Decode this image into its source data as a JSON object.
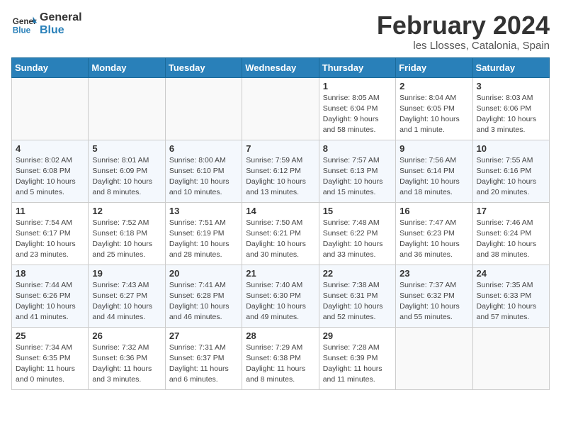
{
  "header": {
    "logo_general": "General",
    "logo_blue": "Blue",
    "month_title": "February 2024",
    "location": "les Llosses, Catalonia, Spain"
  },
  "weekdays": [
    "Sunday",
    "Monday",
    "Tuesday",
    "Wednesday",
    "Thursday",
    "Friday",
    "Saturday"
  ],
  "weeks": [
    [
      {
        "day": "",
        "info": ""
      },
      {
        "day": "",
        "info": ""
      },
      {
        "day": "",
        "info": ""
      },
      {
        "day": "",
        "info": ""
      },
      {
        "day": "1",
        "info": "Sunrise: 8:05 AM\nSunset: 6:04 PM\nDaylight: 9 hours\nand 58 minutes."
      },
      {
        "day": "2",
        "info": "Sunrise: 8:04 AM\nSunset: 6:05 PM\nDaylight: 10 hours\nand 1 minute."
      },
      {
        "day": "3",
        "info": "Sunrise: 8:03 AM\nSunset: 6:06 PM\nDaylight: 10 hours\nand 3 minutes."
      }
    ],
    [
      {
        "day": "4",
        "info": "Sunrise: 8:02 AM\nSunset: 6:08 PM\nDaylight: 10 hours\nand 5 minutes."
      },
      {
        "day": "5",
        "info": "Sunrise: 8:01 AM\nSunset: 6:09 PM\nDaylight: 10 hours\nand 8 minutes."
      },
      {
        "day": "6",
        "info": "Sunrise: 8:00 AM\nSunset: 6:10 PM\nDaylight: 10 hours\nand 10 minutes."
      },
      {
        "day": "7",
        "info": "Sunrise: 7:59 AM\nSunset: 6:12 PM\nDaylight: 10 hours\nand 13 minutes."
      },
      {
        "day": "8",
        "info": "Sunrise: 7:57 AM\nSunset: 6:13 PM\nDaylight: 10 hours\nand 15 minutes."
      },
      {
        "day": "9",
        "info": "Sunrise: 7:56 AM\nSunset: 6:14 PM\nDaylight: 10 hours\nand 18 minutes."
      },
      {
        "day": "10",
        "info": "Sunrise: 7:55 AM\nSunset: 6:16 PM\nDaylight: 10 hours\nand 20 minutes."
      }
    ],
    [
      {
        "day": "11",
        "info": "Sunrise: 7:54 AM\nSunset: 6:17 PM\nDaylight: 10 hours\nand 23 minutes."
      },
      {
        "day": "12",
        "info": "Sunrise: 7:52 AM\nSunset: 6:18 PM\nDaylight: 10 hours\nand 25 minutes."
      },
      {
        "day": "13",
        "info": "Sunrise: 7:51 AM\nSunset: 6:19 PM\nDaylight: 10 hours\nand 28 minutes."
      },
      {
        "day": "14",
        "info": "Sunrise: 7:50 AM\nSunset: 6:21 PM\nDaylight: 10 hours\nand 30 minutes."
      },
      {
        "day": "15",
        "info": "Sunrise: 7:48 AM\nSunset: 6:22 PM\nDaylight: 10 hours\nand 33 minutes."
      },
      {
        "day": "16",
        "info": "Sunrise: 7:47 AM\nSunset: 6:23 PM\nDaylight: 10 hours\nand 36 minutes."
      },
      {
        "day": "17",
        "info": "Sunrise: 7:46 AM\nSunset: 6:24 PM\nDaylight: 10 hours\nand 38 minutes."
      }
    ],
    [
      {
        "day": "18",
        "info": "Sunrise: 7:44 AM\nSunset: 6:26 PM\nDaylight: 10 hours\nand 41 minutes."
      },
      {
        "day": "19",
        "info": "Sunrise: 7:43 AM\nSunset: 6:27 PM\nDaylight: 10 hours\nand 44 minutes."
      },
      {
        "day": "20",
        "info": "Sunrise: 7:41 AM\nSunset: 6:28 PM\nDaylight: 10 hours\nand 46 minutes."
      },
      {
        "day": "21",
        "info": "Sunrise: 7:40 AM\nSunset: 6:30 PM\nDaylight: 10 hours\nand 49 minutes."
      },
      {
        "day": "22",
        "info": "Sunrise: 7:38 AM\nSunset: 6:31 PM\nDaylight: 10 hours\nand 52 minutes."
      },
      {
        "day": "23",
        "info": "Sunrise: 7:37 AM\nSunset: 6:32 PM\nDaylight: 10 hours\nand 55 minutes."
      },
      {
        "day": "24",
        "info": "Sunrise: 7:35 AM\nSunset: 6:33 PM\nDaylight: 10 hours\nand 57 minutes."
      }
    ],
    [
      {
        "day": "25",
        "info": "Sunrise: 7:34 AM\nSunset: 6:35 PM\nDaylight: 11 hours\nand 0 minutes."
      },
      {
        "day": "26",
        "info": "Sunrise: 7:32 AM\nSunset: 6:36 PM\nDaylight: 11 hours\nand 3 minutes."
      },
      {
        "day": "27",
        "info": "Sunrise: 7:31 AM\nSunset: 6:37 PM\nDaylight: 11 hours\nand 6 minutes."
      },
      {
        "day": "28",
        "info": "Sunrise: 7:29 AM\nSunset: 6:38 PM\nDaylight: 11 hours\nand 8 minutes."
      },
      {
        "day": "29",
        "info": "Sunrise: 7:28 AM\nSunset: 6:39 PM\nDaylight: 11 hours\nand 11 minutes."
      },
      {
        "day": "",
        "info": ""
      },
      {
        "day": "",
        "info": ""
      }
    ]
  ]
}
